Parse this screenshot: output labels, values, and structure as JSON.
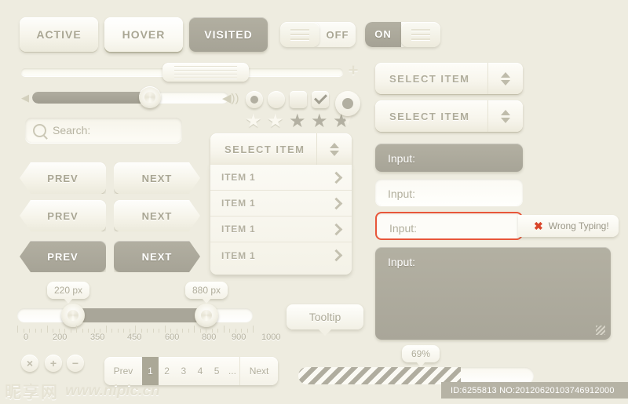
{
  "buttons": {
    "active": "ACTIVE",
    "hover": "HOVER",
    "visited": "VISITED"
  },
  "toggles": {
    "off_label": "OFF",
    "on_label": "ON"
  },
  "search": {
    "placeholder": "Search:",
    "icon": "search-icon"
  },
  "selects": {
    "item_1": "SELECT  ITEM",
    "item_2": "SELECT  ITEM",
    "dropdown_head": "SELECT  ITEM",
    "dropdown_items": [
      "ITEM 1",
      "ITEM 1",
      "ITEM 1",
      "ITEM 1"
    ]
  },
  "nav": {
    "prev": "PREV",
    "next": "NEXT"
  },
  "inputs": {
    "dark": "Input:",
    "plain": "Input:",
    "error": "Input:",
    "textarea": "Input:",
    "error_badge": "Wrong Typing!",
    "error_icon": "✖",
    "error_color": "#e8563a"
  },
  "range": {
    "min_bubble": "220 px",
    "max_bubble": "880 px",
    "tick_labels": [
      "0",
      "200",
      "350",
      "450",
      "600",
      "800",
      "900",
      "1000"
    ]
  },
  "tooltip": {
    "label": "Tooltip"
  },
  "icon_buttons": [
    {
      "name": "close-icon",
      "glyph": "×"
    },
    {
      "name": "plus-icon",
      "glyph": "+"
    },
    {
      "name": "minus-icon",
      "glyph": "−"
    }
  ],
  "pagination": {
    "prev": "Prev",
    "pages": [
      "1",
      "2",
      "3",
      "4",
      "5"
    ],
    "dots": "...",
    "next": "Next",
    "active_page": "1"
  },
  "progress": {
    "percent_label": "69%",
    "percent_value": 69
  },
  "footer": {
    "id_text": "ID:6255813 NO:20120620103746912000"
  },
  "watermark": {
    "cn": "昵享网",
    "url": "www.nipic.cn"
  },
  "rating": {
    "filled": 3,
    "total": 5,
    "glyph": "★"
  },
  "colors": {
    "background": "#eeece0",
    "dark_gray": "#a9a699",
    "text_gray": "#b0ad9b",
    "error_red": "#e8563a"
  }
}
